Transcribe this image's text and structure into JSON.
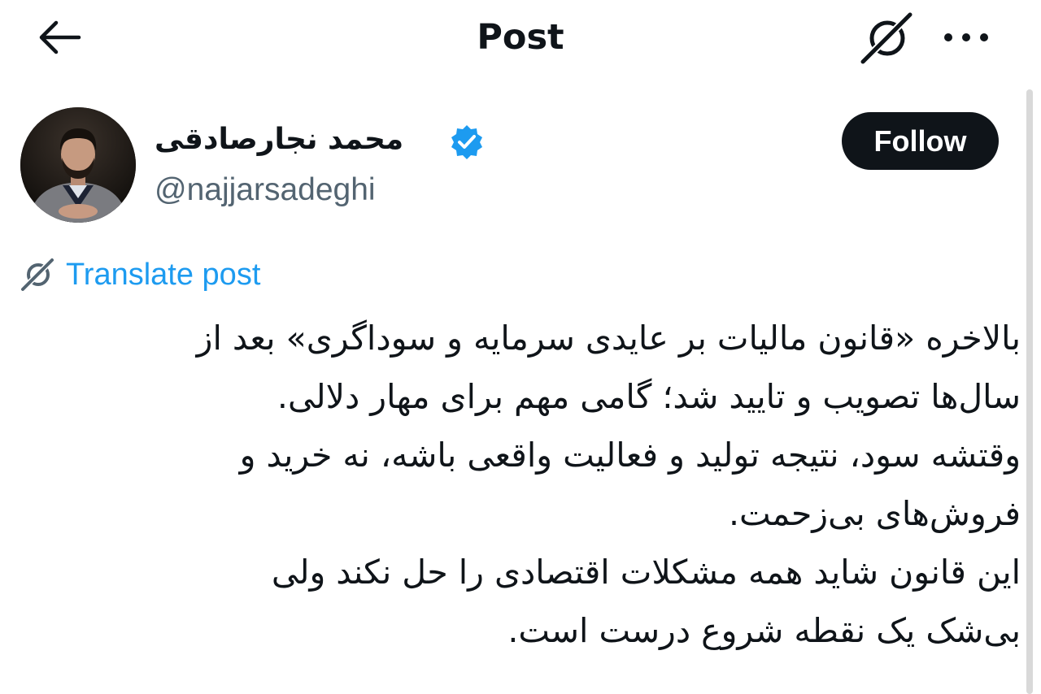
{
  "header": {
    "title": "Post",
    "back_icon": "arrow-left-icon",
    "grok_icon": "grok-icon",
    "more_icon": "more-dots-icon"
  },
  "author": {
    "display_name": "محمد نجارصادقی",
    "handle": "@najjarsadeghi",
    "verified": true,
    "verified_color": "#1d9bf0"
  },
  "follow_button": {
    "label": "Follow"
  },
  "translate": {
    "label": "Translate post",
    "color": "#1d9bf0"
  },
  "post": {
    "lines": [
      "بالاخره «قانون مالیات بر عایدی سرمایه و سوداگری» بعد از",
      "سال‌ها تصویب و تایید شد؛ گامی مهم برای مهار دلالی.",
      "وقتشه سود، نتیجه تولید و فعالیت واقعی باشه، نه خرید و",
      "فروش‌های بی‌زحمت.",
      "این قانون شاید همه مشکلات اقتصادی را حل نکند ولی",
      "بی‌شک یک نقطه شروع درست است."
    ]
  },
  "colors": {
    "text_primary": "#0f1419",
    "text_secondary": "#536471",
    "accent": "#1d9bf0",
    "follow_bg": "#0f1419"
  }
}
